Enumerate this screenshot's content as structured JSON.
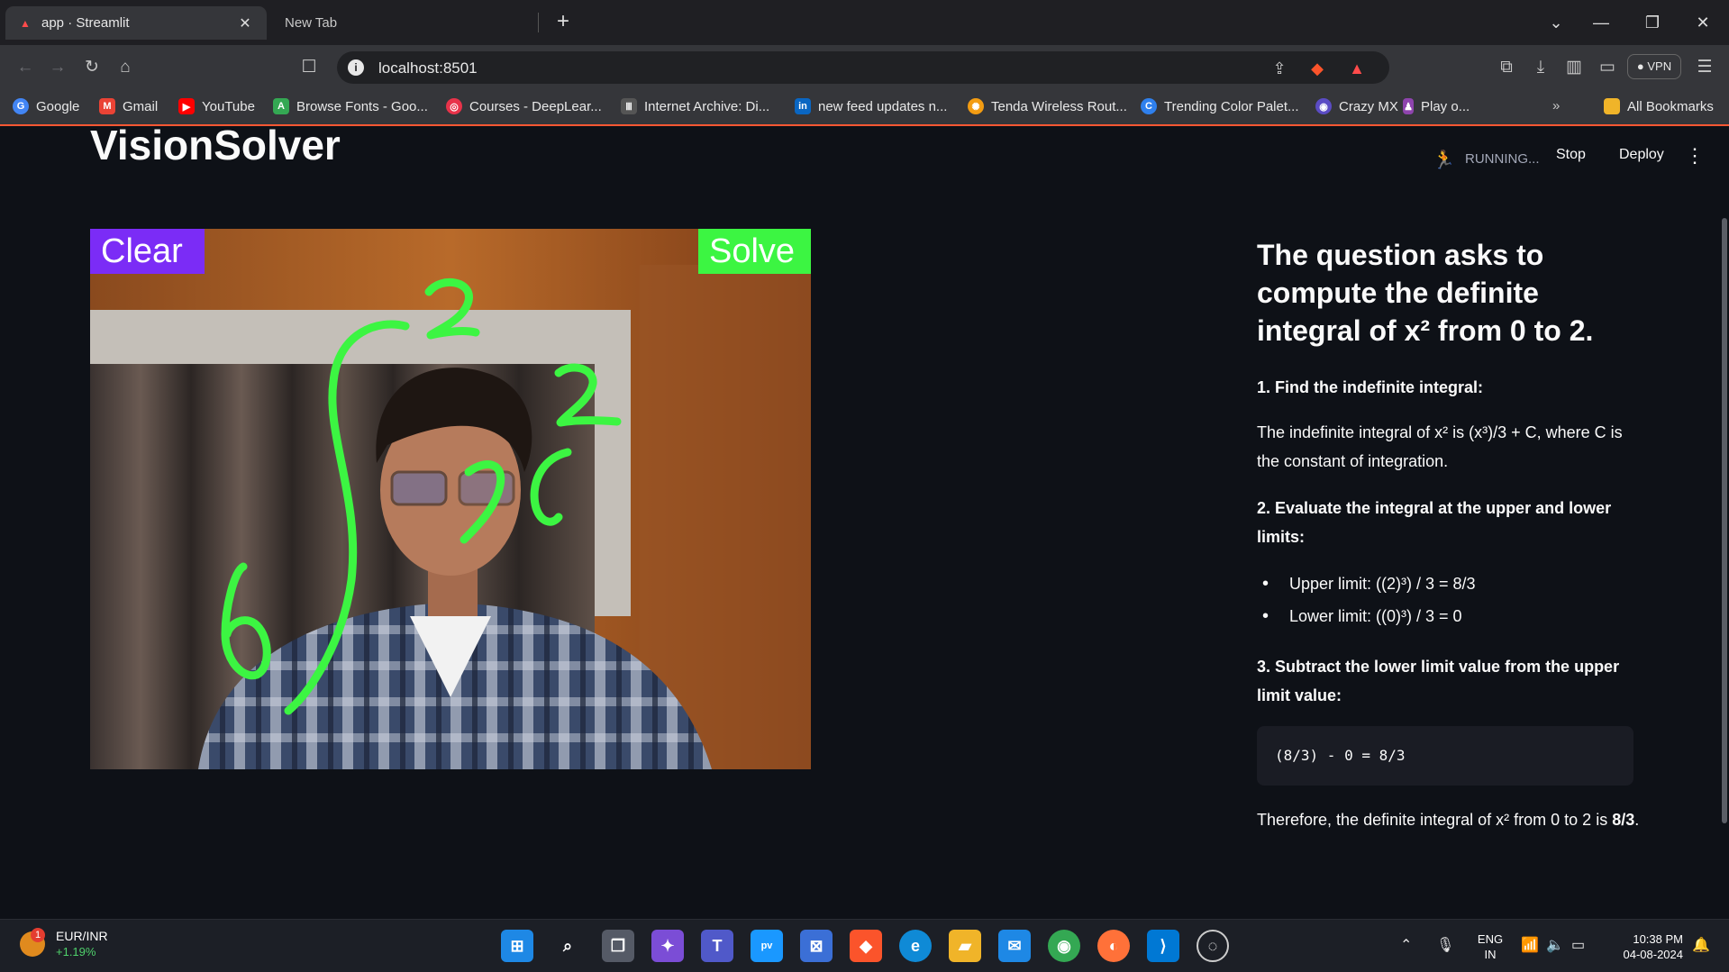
{
  "browser": {
    "tabs": [
      {
        "label": "app · Streamlit",
        "active": true
      },
      {
        "label": "New Tab",
        "active": false
      }
    ],
    "address": "localhost:8501",
    "vpn_label": "VPN",
    "bookmarks": [
      {
        "label": "Google",
        "icon": "google-icon",
        "color": "#4285f4"
      },
      {
        "label": "Gmail",
        "icon": "gmail-icon",
        "color": "#ea4335"
      },
      {
        "label": "YouTube",
        "icon": "youtube-icon",
        "color": "#ff0000"
      },
      {
        "label": "Browse Fonts - Goo...",
        "icon": "fonts-icon",
        "color": "#34a853"
      },
      {
        "label": "Courses - DeepLear...",
        "icon": "deeplearning-icon",
        "color": "#e8334a"
      },
      {
        "label": "Internet Archive: Di...",
        "icon": "archive-icon",
        "color": "#cccccc"
      },
      {
        "label": "new feed updates n...",
        "icon": "linkedin-icon",
        "color": "#0a66c2"
      },
      {
        "label": "Tenda Wireless Rout...",
        "icon": "tenda-icon",
        "color": "#f39c12"
      },
      {
        "label": "Trending Color Palet...",
        "icon": "coolors-icon",
        "color": "#2f80ed"
      },
      {
        "label": "Crazy MX",
        "icon": "crazymx-icon",
        "color": "#5b4cc4"
      },
      {
        "label": "Play o...",
        "icon": "play-icon",
        "color": "#8e44ad"
      }
    ],
    "all_bookmarks": "All Bookmarks",
    "accent_color": "#ff5733"
  },
  "streamlit": {
    "status": "RUNNING...",
    "stop": "Stop",
    "deploy": "Deploy"
  },
  "app": {
    "title": "VisionSolver",
    "canvas_buttons": {
      "clear": "Clear",
      "solve": "Solve"
    },
    "clear_color": "#7b2cf6",
    "solve_color": "#3cf542",
    "stroke_color": "#3cf542"
  },
  "answer": {
    "heading": "The question asks to compute the definite integral of x² from 0 to 2.",
    "step1": "1. Find the indefinite integral:",
    "step1_text": "The indefinite integral of x² is (x³)/3 + C, where C is the constant of integration.",
    "step2": "2. Evaluate the integral at the upper and lower limits:",
    "upper": "Upper limit: ((2)³) / 3 = 8/3",
    "lower": "Lower limit: ((0)³) / 3 = 0",
    "step3": "3. Subtract the lower limit value from the upper limit value:",
    "code": "(8/3) - 0 = 8/3",
    "final_text": "Therefore, the definite integral of x² from 0 to 2 is ",
    "final_value": "8/3",
    "final_end": "."
  },
  "taskbar": {
    "ticker_name": "EUR/INR",
    "ticker_change": "+1.19%",
    "ticker_badge": "1",
    "lang_top": "ENG",
    "lang_bottom": "IN",
    "time": "10:38 PM",
    "date": "04-08-2024"
  }
}
